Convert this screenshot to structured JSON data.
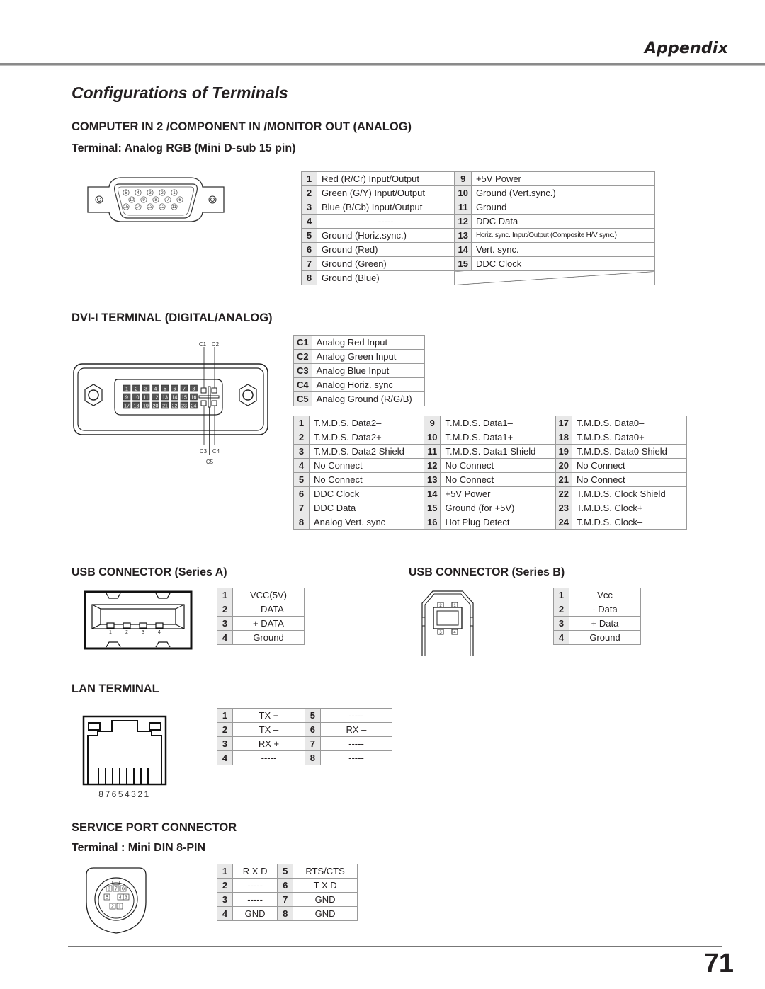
{
  "header": {
    "section": "Appendix",
    "page_title": "Configurations of Terminals",
    "page_number": "71"
  },
  "vga": {
    "heading": "COMPUTER IN 2 /COMPONENT IN /MONITOR OUT (ANALOG)",
    "subheading": "Terminal: Analog RGB (Mini D-sub 15 pin)",
    "connector_pins": {
      "row1": [
        "5",
        "4",
        "3",
        "2",
        "1"
      ],
      "row2": [
        "10",
        "9",
        "8",
        "7",
        "6"
      ],
      "row3": [
        "15",
        "14",
        "13",
        "12",
        "11"
      ]
    },
    "left": [
      {
        "n": "1",
        "v": "Red (R/Cr) Input/Output"
      },
      {
        "n": "2",
        "v": "Green (G/Y) Input/Output"
      },
      {
        "n": "3",
        "v": "Blue (B/Cb) Input/Output"
      },
      {
        "n": "4",
        "v": "-----"
      },
      {
        "n": "5",
        "v": "Ground (Horiz.sync.)"
      },
      {
        "n": "6",
        "v": "Ground (Red)"
      },
      {
        "n": "7",
        "v": "Ground (Green)"
      },
      {
        "n": "8",
        "v": "Ground (Blue)"
      }
    ],
    "right": [
      {
        "n": "9",
        "v": "+5V Power"
      },
      {
        "n": "10",
        "v": "Ground (Vert.sync.)"
      },
      {
        "n": "11",
        "v": "Ground"
      },
      {
        "n": "12",
        "v": "DDC Data"
      },
      {
        "n": "13",
        "v": "Horiz. sync. Input/Output (Composite H/V sync.)"
      },
      {
        "n": "14",
        "v": "Vert. sync."
      },
      {
        "n": "15",
        "v": "DDC Clock"
      }
    ]
  },
  "dvi": {
    "heading": "DVI-I TERMINAL (DIGITAL/ANALOG)",
    "labels": {
      "c1": "C1",
      "c2": "C2",
      "c3": "C3",
      "c4": "C4",
      "c5": "C5"
    },
    "analog": [
      {
        "n": "C1",
        "v": "Analog Red Input"
      },
      {
        "n": "C2",
        "v": "Analog Green Input"
      },
      {
        "n": "C3",
        "v": "Analog Blue Input"
      },
      {
        "n": "C4",
        "v": "Analog Horiz. sync"
      },
      {
        "n": "C5",
        "v": "Analog Ground (R/G/B)"
      }
    ],
    "col1": [
      {
        "n": "1",
        "v": "T.M.D.S. Data2–"
      },
      {
        "n": "2",
        "v": "T.M.D.S. Data2+"
      },
      {
        "n": "3",
        "v": "T.M.D.S. Data2 Shield"
      },
      {
        "n": "4",
        "v": "No Connect"
      },
      {
        "n": "5",
        "v": "No Connect"
      },
      {
        "n": "6",
        "v": "DDC Clock"
      },
      {
        "n": "7",
        "v": "DDC Data"
      },
      {
        "n": "8",
        "v": "Analog Vert. sync"
      }
    ],
    "col2": [
      {
        "n": "9",
        "v": "T.M.D.S. Data1–"
      },
      {
        "n": "10",
        "v": "T.M.D.S. Data1+"
      },
      {
        "n": "11",
        "v": "T.M.D.S. Data1 Shield"
      },
      {
        "n": "12",
        "v": "No Connect"
      },
      {
        "n": "13",
        "v": "No Connect"
      },
      {
        "n": "14",
        "v": "+5V Power"
      },
      {
        "n": "15",
        "v": "Ground (for +5V)"
      },
      {
        "n": "16",
        "v": "Hot Plug Detect"
      }
    ],
    "col3": [
      {
        "n": "17",
        "v": "T.M.D.S. Data0–"
      },
      {
        "n": "18",
        "v": "T.M.D.S. Data0+"
      },
      {
        "n": "19",
        "v": "T.M.D.S. Data0 Shield"
      },
      {
        "n": "20",
        "v": "No Connect"
      },
      {
        "n": "21",
        "v": "No Connect"
      },
      {
        "n": "22",
        "v": "T.M.D.S. Clock Shield"
      },
      {
        "n": "23",
        "v": "T.M.D.S. Clock+"
      },
      {
        "n": "24",
        "v": "T.M.D.S. Clock–"
      }
    ]
  },
  "usb_a": {
    "heading": "USB CONNECTOR (Series A)",
    "pin_labels": [
      "1",
      "2",
      "3",
      "4"
    ],
    "pins": [
      {
        "n": "1",
        "v": "VCC(5V)"
      },
      {
        "n": "2",
        "v": "– DATA"
      },
      {
        "n": "3",
        "v": "+ DATA"
      },
      {
        "n": "4",
        "v": "Ground"
      }
    ]
  },
  "usb_b": {
    "heading": "USB CONNECTOR (Series B)",
    "pin_labels": [
      "2",
      "1",
      "3",
      "4"
    ],
    "pins": [
      {
        "n": "1",
        "v": "Vcc"
      },
      {
        "n": "2",
        "v": "- Data"
      },
      {
        "n": "3",
        "v": "+ Data"
      },
      {
        "n": "4",
        "v": "Ground"
      }
    ]
  },
  "lan": {
    "heading": "LAN TERMINAL",
    "pin_numbers": "87654321",
    "left": [
      {
        "n": "1",
        "v": "TX +"
      },
      {
        "n": "2",
        "v": "TX –"
      },
      {
        "n": "3",
        "v": "RX +"
      },
      {
        "n": "4",
        "v": "-----"
      }
    ],
    "right": [
      {
        "n": "5",
        "v": "-----"
      },
      {
        "n": "6",
        "v": "RX –"
      },
      {
        "n": "7",
        "v": "-----"
      },
      {
        "n": "8",
        "v": "-----"
      }
    ]
  },
  "service": {
    "heading": "SERVICE PORT CONNECTOR",
    "subheading": "Terminal : Mini DIN 8-PIN",
    "connector_pins": {
      "row1": [
        "8",
        "7",
        "6"
      ],
      "row2": [
        "5",
        "4",
        "3"
      ],
      "row3": [
        "2",
        "1"
      ]
    },
    "left": [
      {
        "n": "1",
        "v": "R X D"
      },
      {
        "n": "2",
        "v": "-----"
      },
      {
        "n": "3",
        "v": "-----"
      },
      {
        "n": "4",
        "v": "GND"
      }
    ],
    "right": [
      {
        "n": "5",
        "v": "RTS/CTS"
      },
      {
        "n": "6",
        "v": "T X D"
      },
      {
        "n": "7",
        "v": "GND"
      },
      {
        "n": "8",
        "v": "GND"
      }
    ]
  }
}
